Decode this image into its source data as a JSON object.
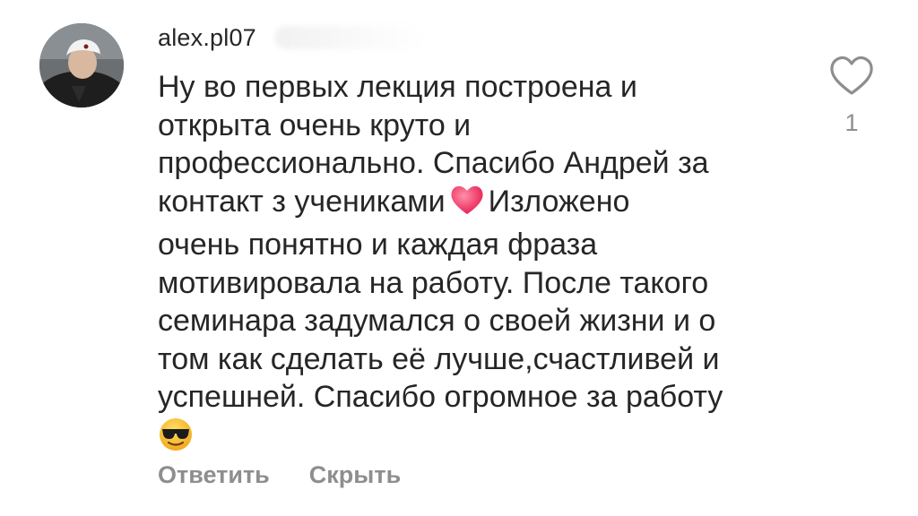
{
  "comment": {
    "username": "alex.pl07",
    "avatar_icon": "user-avatar-photo",
    "text_lines": [
      "Ну во первых лекция построена и",
      "открыта очень круто и",
      "профессионально. Спасибо Андрей за",
      "контакт з учениками",
      "Изложено",
      "очень понятно и каждая фраза",
      "мотивировала на работу. После такого",
      "семинара задумался о своей жизни и о",
      "том как сделать её лучше,счастливей и",
      "успешней. Спасибо огромное за работу"
    ],
    "emojis": [
      "heart-emoji",
      "sunglasses-smiley-emoji"
    ],
    "like_icon": "heart-outline-icon",
    "like_count": "1"
  },
  "actions": {
    "reply_label": "Ответить",
    "hide_label": "Скрыть"
  },
  "colors": {
    "text": "#262626",
    "muted": "#8e8e8e",
    "heart_emoji": "#f0436a",
    "sunglasses_face": "#f7c531"
  }
}
